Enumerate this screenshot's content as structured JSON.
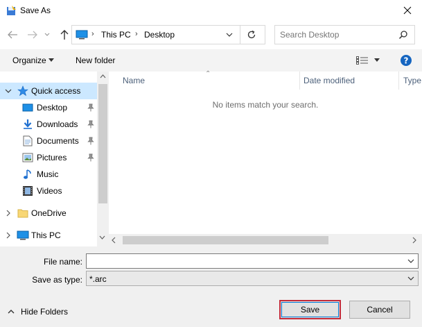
{
  "window": {
    "title": "Save As"
  },
  "address": {
    "crumbs": [
      "This PC",
      "Desktop"
    ]
  },
  "search": {
    "placeholder": "Search Desktop"
  },
  "toolbar": {
    "organize_label": "Organize",
    "new_folder_label": "New folder"
  },
  "nav": {
    "quick_access": "Quick access",
    "items": [
      {
        "label": "Desktop",
        "icon": "desktop-icon",
        "pinned": true
      },
      {
        "label": "Downloads",
        "icon": "download-icon",
        "pinned": true
      },
      {
        "label": "Documents",
        "icon": "documents-icon",
        "pinned": true
      },
      {
        "label": "Pictures",
        "icon": "pictures-icon",
        "pinned": true
      },
      {
        "label": "Music",
        "icon": "music-icon",
        "pinned": false
      },
      {
        "label": "Videos",
        "icon": "videos-icon",
        "pinned": false
      }
    ],
    "onedrive": "OneDrive",
    "this_pc": "This PC"
  },
  "columns": {
    "name": "Name",
    "date": "Date modified",
    "type": "Type"
  },
  "empty_message": "No items match your search.",
  "form": {
    "file_name_label": "File name:",
    "file_name_value": "",
    "save_type_label": "Save as type:",
    "save_type_value": "*.arc"
  },
  "footer": {
    "hide_folders": "Hide Folders",
    "save": "Save",
    "cancel": "Cancel"
  },
  "colors": {
    "selection": "#cce8ff",
    "accent": "#0078d7",
    "focus_outline": "#c42b3a"
  }
}
